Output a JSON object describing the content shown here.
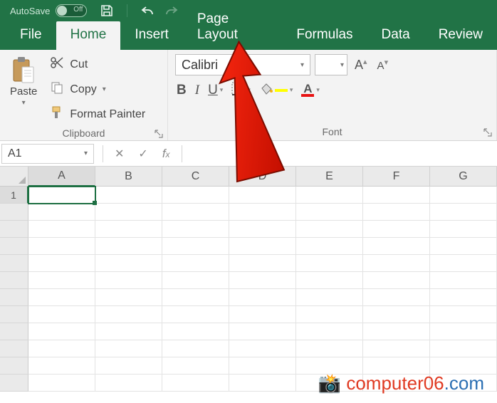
{
  "titlebar": {
    "autosave_label": "AutoSave",
    "autosave_off": "Off"
  },
  "tabs": {
    "file": "File",
    "home": "Home",
    "insert": "Insert",
    "page_layout": "Page Layout",
    "formulas": "Formulas",
    "data": "Data",
    "review": "Review"
  },
  "clipboard": {
    "paste": "Paste",
    "cut": "Cut",
    "copy": "Copy",
    "format_painter": "Format Painter",
    "group_label": "Clipboard"
  },
  "font": {
    "name": "Calibri",
    "group_label": "Font",
    "bold": "B",
    "italic": "I",
    "underline": "U",
    "increase": "A",
    "decrease": "A",
    "font_color_sample": "A",
    "fill_color": "#ffff00",
    "font_color": "#e81313"
  },
  "namebox": {
    "value": "A1"
  },
  "columns": [
    "A",
    "B",
    "C",
    "D",
    "E",
    "F",
    "G"
  ],
  "row_count": 12,
  "active_cell": {
    "col": "A",
    "row": 1
  },
  "watermark": {
    "prefix": "📸 ",
    "text": "computer06",
    "suffix": ".com"
  },
  "colors": {
    "brand": "#217346"
  }
}
